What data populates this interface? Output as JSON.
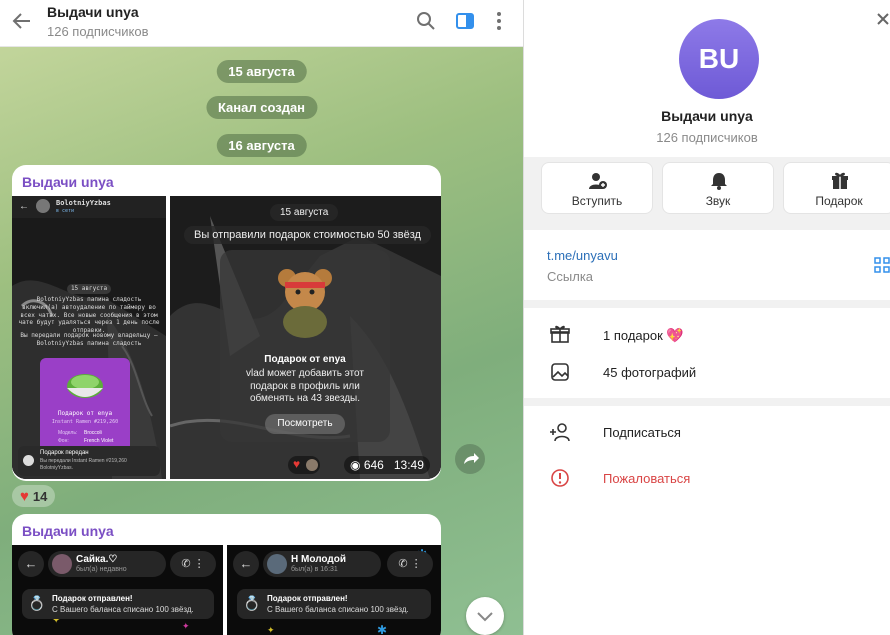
{
  "header": {
    "title": "Выдачи unya",
    "subtitle": "126 подписчиков"
  },
  "messages": {
    "date1": "15 августа",
    "service": "Канал создан",
    "date2": "16 августа",
    "post1": {
      "channel": "Выдачи unya",
      "shot1": {
        "username": "BolotniyYzbas",
        "status": "в сети",
        "date": "15 августа",
        "text1": "BolotniyYzbas папина сладость включил(а) автоудаление по таймеру во всех чатах. Все новые сообщения в этом чате будут удаляться через 1 день после отправки.",
        "text2": "Вы передали подарок новому владельцу — BolotniyYzbas папина сладость",
        "gift_from": "Подарок от enya",
        "gift_name": "Instant Ramen #219,260",
        "model_label": "Модель:",
        "model_value": "Broccoli",
        "bg_label": "Фон:",
        "bg_value": "French Violet",
        "transfer_title": "Подарок передан",
        "transfer_text": "Вы передали Instant Ramen #219,260",
        "transfer_user": "BolotniyYzbas."
      },
      "shot2": {
        "date": "15 августа",
        "sent": "Вы отправили подарок стоимостью 50 звёзд",
        "gift_title": "Подарок от",
        "gift_user": "enya",
        "gift_text": "vlad может добавить этот подарок в профиль или обменять на 43 звезды.",
        "view_button": "Посмотреть"
      },
      "views": "646",
      "time": "13:49",
      "reaction_count": "14"
    },
    "post2": {
      "channel": "Выдачи unya",
      "shot1": {
        "name": "Сайка.♡",
        "status": "был(а) недавно",
        "gift_title": "Подарок отправлен!",
        "gift_text": "С Вашего баланса списано 100 звёзд."
      },
      "shot2": {
        "name": "Н Молодой",
        "status": "был(а) в 16:31",
        "gift_title": "Подарок отправлен!",
        "gift_text": "С Вашего баланса списано 100 звёзд."
      }
    }
  },
  "profile": {
    "avatar_initials": "BU",
    "name": "Выдачи unya",
    "subscribers": "126 подписчиков",
    "actions": [
      {
        "label": "Вступить",
        "icon": "add-user-icon"
      },
      {
        "label": "Звук",
        "icon": "bell-icon"
      },
      {
        "label": "Подарок",
        "icon": "gift-icon"
      }
    ],
    "link": "t.me/unyavu",
    "link_caption": "Ссылка",
    "gifts": "1 подарок",
    "photos": "45 фотографий",
    "subscribe": "Подписаться",
    "report": "Пожаловаться"
  },
  "colors": {
    "accent": "#7b4fc4",
    "link": "#2b6fb8",
    "danger": "#d94545"
  }
}
